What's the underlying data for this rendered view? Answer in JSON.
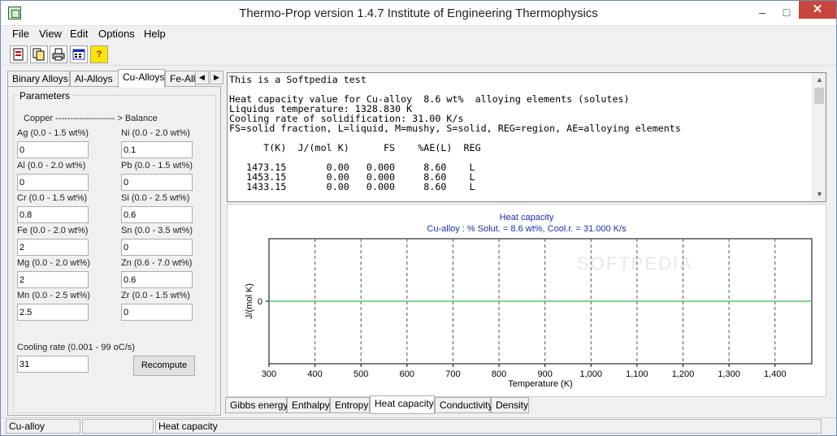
{
  "window": {
    "title": "Thermo-Prop version 1.4.7  Institute of Engineering Thermophysics",
    "minimize": "–",
    "maximize": "□",
    "close": "✕"
  },
  "menu": [
    "File",
    "View",
    "Edit",
    "Options",
    "Help"
  ],
  "toolbar": [
    {
      "icon": "open-report-icon"
    },
    {
      "icon": "copy-icon"
    },
    {
      "icon": "print-icon"
    },
    {
      "icon": "calculator-icon"
    },
    {
      "icon": "help-icon",
      "glyph": "?"
    }
  ],
  "top_tabs": [
    "Binary Alloys",
    "Al-Alloys",
    "Cu-Alloys",
    "Fe-Allo"
  ],
  "params": {
    "legend": "Parameters",
    "base": "Copper -------------------- > Balance",
    "fields": [
      {
        "label": "Ag (0.0 - 1.5 wt%)",
        "value": "0"
      },
      {
        "label": "Ni (0.0 - 2.0 wt%)",
        "value": "0.1"
      },
      {
        "label": "Al (0.0 - 2.0 wt%)",
        "value": "0"
      },
      {
        "label": "Pb (0.0 - 1.5 wt%)",
        "value": "0"
      },
      {
        "label": "Cr (0.0 - 1.5 wt%)",
        "value": "0.8"
      },
      {
        "label": "Si (0.0 - 2.5 wt%)",
        "value": "0.6"
      },
      {
        "label": "Fe (0.0 - 2.0 wt%)",
        "value": "2"
      },
      {
        "label": "Sn (0.0 - 3.5 wt%)",
        "value": "0"
      },
      {
        "label": "Mg (0.0 - 2.0 wt%)",
        "value": "2"
      },
      {
        "label": "Zn (0.6 - 7.0 wt%)",
        "value": "0.6"
      },
      {
        "label": "Mn (0.0 - 2.5 wt%)",
        "value": "2.5"
      },
      {
        "label": "Zr (0.0 - 1.5 wt%)",
        "value": "0"
      }
    ],
    "cooling_label": "Cooling rate (0.001 - 99 oC/s)",
    "cooling_value": "31",
    "recompute": "Recompute"
  },
  "output_text": "This is a Softpedia test\n\nHeat capacity value for Cu-alloy  8.6 wt%  alloying elements (solutes)\nLiquidus temperature: 1328.830 K\nCooling rate of solidification: 31.00 K/s\nFS=solid fraction, L=liquid, M=mushy, S=solid, REG=region, AE=alloying elements\n\n      T(K)  J/(mol K)      FS    %AE(L)  REG\n\n   1473.15       0.00   0.000     8.60    L\n   1453.15       0.00   0.000     8.60    L\n   1433.15       0.00   0.000     8.60    L",
  "chart": {
    "title": "Heat capacity",
    "subtitle": "Cu-alloy : % Solut. =  8.6  wt%, Cool.r. = 31.000 K/s",
    "watermark": "SOFTPEDIA"
  },
  "chart_data": {
    "type": "line",
    "title": "Heat capacity",
    "subtitle": "Cu-alloy : % Solut. =  8.6  wt%, Cool.r. = 31.000 K/s",
    "xlabel": "Temperature (K)",
    "ylabel": "J/(mol K)",
    "xlim": [
      300,
      1480
    ],
    "x_ticks": [
      "300",
      "400",
      "500",
      "600",
      "700",
      "800",
      "900",
      "1,000",
      "1,100",
      "1,200",
      "1,300",
      "1,400"
    ],
    "y_ticks": [
      "0"
    ],
    "grid": "vertical dashed",
    "series": [
      {
        "x": [
          300,
          1480
        ],
        "y": [
          0,
          0
        ],
        "color": "#3cb44b"
      }
    ]
  },
  "bottom_tabs": [
    "Gibbs energy",
    "Enthalpy",
    "Entropy",
    "Heat capacity",
    "Conductivity",
    "Density"
  ],
  "status": [
    "Cu-alloy",
    "",
    "Heat capacity"
  ]
}
